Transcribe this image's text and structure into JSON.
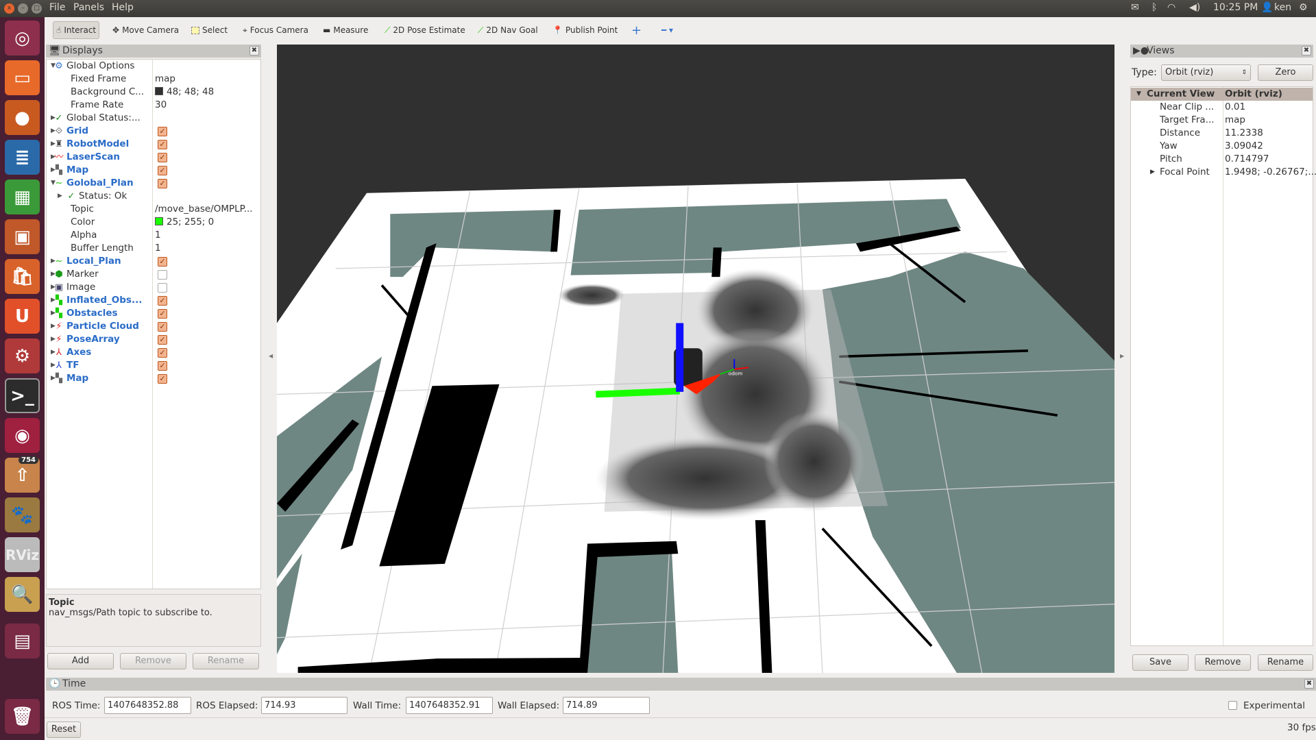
{
  "menubar": {
    "items": [
      "File",
      "Panels",
      "Help"
    ],
    "time": "10:25 PM",
    "user": "ken",
    "launcher_badge": "754"
  },
  "toolbar": {
    "tools": [
      "Interact",
      "Move Camera",
      "Select",
      "Focus Camera",
      "Measure",
      "2D Pose Estimate",
      "2D Nav Goal",
      "Publish Point"
    ],
    "active": "Interact"
  },
  "displays": {
    "title": "Displays",
    "rows": [
      {
        "label": "Global Options",
        "value": ""
      },
      {
        "label": "Fixed Frame",
        "value": "map"
      },
      {
        "label": "Background C...",
        "value": "48; 48; 48",
        "swatch": "#303030"
      },
      {
        "label": "Frame Rate",
        "value": "30"
      },
      {
        "label": "Global Status:...",
        "value": ""
      },
      {
        "label": "Grid",
        "checked": true
      },
      {
        "label": "RobotModel",
        "checked": true
      },
      {
        "label": "LaserScan",
        "checked": true
      },
      {
        "label": "Map",
        "checked": true
      },
      {
        "label": "Golobal_Plan",
        "checked": true
      },
      {
        "label": "Status: Ok",
        "value": ""
      },
      {
        "label": "Topic",
        "value": "/move_base/OMPLP..."
      },
      {
        "label": "Color",
        "value": "25; 255; 0",
        "swatch": "#19ff00"
      },
      {
        "label": "Alpha",
        "value": "1"
      },
      {
        "label": "Buffer Length",
        "value": "1"
      },
      {
        "label": "Local_Plan",
        "checked": true
      },
      {
        "label": "Marker",
        "checked": false
      },
      {
        "label": "Image",
        "checked": false
      },
      {
        "label": "Inflated_Obs...",
        "checked": true
      },
      {
        "label": "Obstacles",
        "checked": true
      },
      {
        "label": "Particle Cloud",
        "checked": true
      },
      {
        "label": "PoseArray",
        "checked": true
      },
      {
        "label": "Axes",
        "checked": true
      },
      {
        "label": "TF",
        "checked": true
      },
      {
        "label": "Map",
        "checked": true
      }
    ],
    "desc_title": "Topic",
    "desc_text": "nav_msgs/Path topic to subscribe to.",
    "add": "Add",
    "remove": "Remove",
    "rename": "Rename"
  },
  "views": {
    "title": "Views",
    "type_label": "Type:",
    "type_value": "Orbit (rviz)",
    "zero": "Zero",
    "header": {
      "label": "Current View",
      "value": "Orbit (rviz)"
    },
    "rows": [
      {
        "label": "Near Clip ...",
        "value": "0.01"
      },
      {
        "label": "Target Fra...",
        "value": "map"
      },
      {
        "label": "Distance",
        "value": "11.2338"
      },
      {
        "label": "Yaw",
        "value": "3.09042"
      },
      {
        "label": "Pitch",
        "value": "0.714797"
      },
      {
        "label": "Focal Point",
        "value": "1.9498; -0.26767;..."
      }
    ],
    "save": "Save",
    "remove": "Remove",
    "rename": "Rename"
  },
  "time": {
    "title": "Time",
    "ros_time_label": "ROS Time:",
    "ros_time": "1407648352.88",
    "ros_elapsed_label": "ROS Elapsed:",
    "ros_elapsed": "714.93",
    "wall_time_label": "Wall Time:",
    "wall_time": "1407648352.91",
    "wall_elapsed_label": "Wall Elapsed:",
    "wall_elapsed": "714.89",
    "experimental": "Experimental",
    "reset": "Reset",
    "fps": "30 fps"
  },
  "scene": {
    "tf_label": "odom",
    "colors": {
      "background": "#303030",
      "unknown": "#6f8783",
      "path": "#19ff00"
    }
  }
}
